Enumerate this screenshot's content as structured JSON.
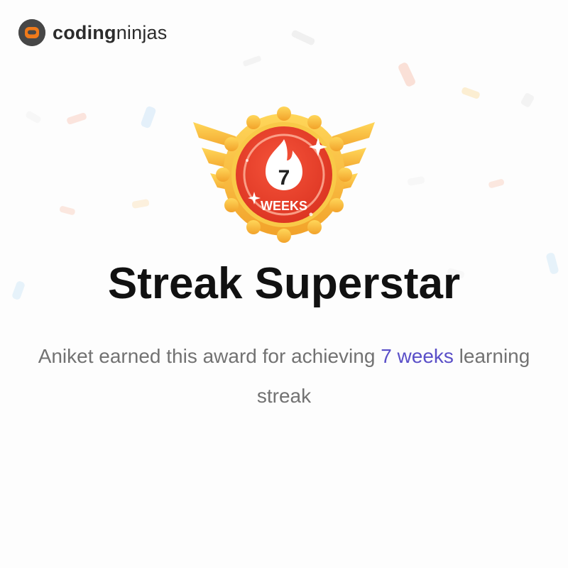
{
  "brand": {
    "name_bold": "coding",
    "name_light": "ninjas",
    "logo_color": "#f07a1a"
  },
  "badge": {
    "number": "7",
    "unit": "WEEKS",
    "ring_color": "#e8412a",
    "gold_color": "#f7b733"
  },
  "title": "Streak Superstar",
  "message": {
    "before": "Aniket earned this award for achieving ",
    "highlight": "7 weeks",
    "after": " learning streak"
  },
  "colors": {
    "highlight": "#5a4fc8",
    "text_muted": "#727272"
  }
}
